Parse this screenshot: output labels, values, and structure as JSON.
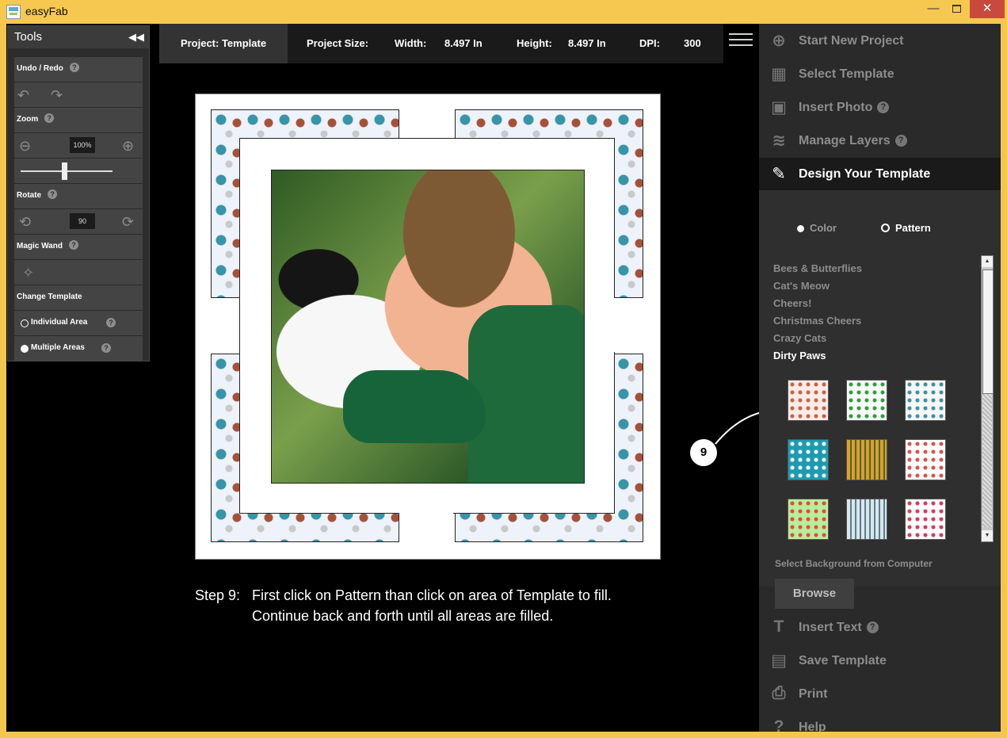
{
  "window": {
    "title": "easyFab",
    "min_glyph": "—",
    "close_glyph": "✕"
  },
  "tools": {
    "title": "Tools",
    "collapse_glyph": "◀◀",
    "undo_redo": "Undo / Redo",
    "zoom": "Zoom",
    "zoom_value": "100%",
    "zoom_level": 0.5,
    "rotate": "Rotate",
    "rotate_value": "90",
    "magic_wand": "Magic Wand",
    "change_template": "Change Template",
    "individual_area": "Individual Area",
    "multiple_areas": "Multiple Areas",
    "help_glyph": "?"
  },
  "project": {
    "name": "Project: Template",
    "size_label": "Project Size:",
    "width_label": "Width:",
    "width": "8.497 In",
    "height_label": "Height:",
    "height": "8.497 In",
    "dpi_label": "DPI:",
    "dpi": "300"
  },
  "step": {
    "label": "Step 9:",
    "text_line_1": "First click on Pattern than click on area of Template to fill.",
    "text_line_2": "Continue back and forth until all areas are filled."
  },
  "callout": {
    "number": "9"
  },
  "sidebar": {
    "items": [
      {
        "label": "Start New Project",
        "icon": "plus-circle-icon"
      },
      {
        "label": "Select Template",
        "icon": "template-icon"
      },
      {
        "label": "Insert Photo",
        "icon": "photo-icon",
        "help": "?"
      },
      {
        "label": "Manage Layers",
        "icon": "layers-icon",
        "help": "?"
      },
      {
        "label": "Design Your Template",
        "icon": "palette-icon",
        "active": true
      },
      {
        "label": "Insert Text",
        "icon": "text-icon",
        "help": "?"
      },
      {
        "label": "Save Template",
        "icon": "save-template-icon"
      },
      {
        "label": "Print",
        "icon": "print-icon"
      },
      {
        "label": "Help",
        "icon": "help-icon"
      }
    ]
  },
  "design": {
    "color_option": "Color",
    "pattern_option": "Pattern",
    "categories": [
      "Bees & Butterflies",
      "Cat's Meow",
      "Cheers!",
      "Christmas Cheers",
      "Crazy Cats",
      "Dirty Paws"
    ],
    "selected_category": "Dirty Paws",
    "swatches": [
      {
        "name": "dots-cream",
        "bg": "#f8ece6",
        "fg": "#c95e4b"
      },
      {
        "name": "paws-green",
        "bg": "#f9f9f9",
        "fg": "#2d9d3b"
      },
      {
        "name": "dogs-hydrants",
        "bg": "#f7f7f7",
        "fg": "#3f8fa3"
      },
      {
        "name": "paws-teal",
        "bg": "#1d9bb0",
        "fg": "#ffffff"
      },
      {
        "name": "stripes-orange",
        "bg": "#e49a2d",
        "fg": "#3b6f29"
      },
      {
        "name": "dots-multicolor",
        "bg": "#ffffff",
        "fg": "#d85050"
      },
      {
        "name": "flowers-green",
        "bg": "#b8ef9a",
        "fg": "#e24848"
      },
      {
        "name": "stripes-multi",
        "bg": "#dbe6ea",
        "fg": "#577f8f"
      },
      {
        "name": "hearts-white",
        "bg": "#fbfbfb",
        "fg": "#cf3d62"
      }
    ],
    "bg_from_computer": "Select Background from Computer",
    "browse": "Browse"
  }
}
